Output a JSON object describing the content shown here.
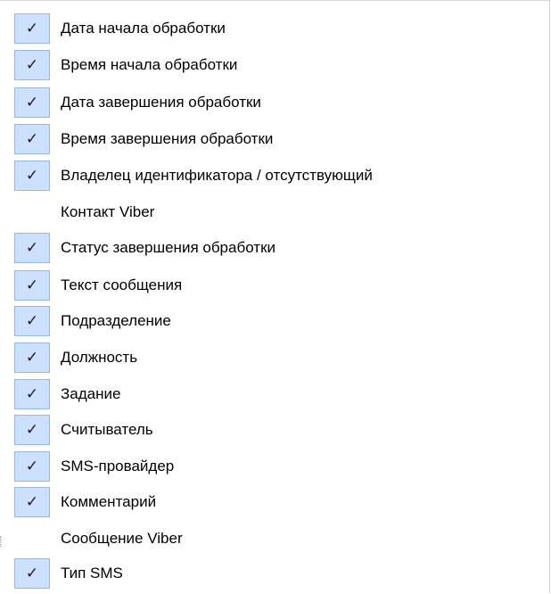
{
  "menu": {
    "items": [
      {
        "label": "Дата начала обработки",
        "checked": true
      },
      {
        "label": "Время начала обработки",
        "checked": true
      },
      {
        "label": "Дата завершения обработки",
        "checked": true
      },
      {
        "label": "Время завершения обработки",
        "checked": true
      },
      {
        "label": "Владелец идентификатора / отсутствующий",
        "checked": true
      },
      {
        "label": "Контакт Viber",
        "checked": false
      },
      {
        "label": "Статус завершения обработки",
        "checked": true
      },
      {
        "label": "Текст сообщения",
        "checked": true
      },
      {
        "label": "Подразделение",
        "checked": true
      },
      {
        "label": "Должность",
        "checked": true
      },
      {
        "label": "Задание",
        "checked": true
      },
      {
        "label": "Считыватель",
        "checked": true
      },
      {
        "label": "SMS-провайдер",
        "checked": true
      },
      {
        "label": "Комментарий",
        "checked": true
      },
      {
        "label": "Сообщение Viber",
        "checked": false
      },
      {
        "label": "Тип SMS",
        "checked": true
      }
    ],
    "check_glyph": "✓"
  },
  "colors": {
    "check_background": "#cce0ff",
    "check_border": "#98b6e2",
    "text": "#000000"
  }
}
